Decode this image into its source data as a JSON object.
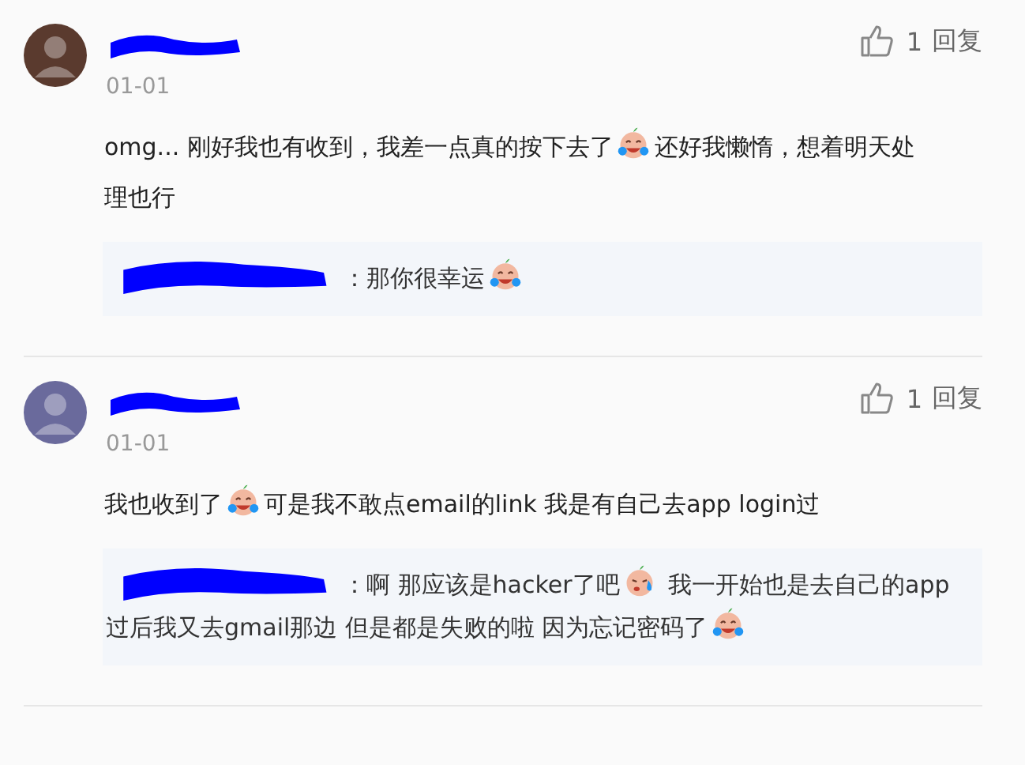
{
  "comments": [
    {
      "avatar": {
        "color": "#5a3a2e"
      },
      "date": "01-01",
      "likes": "1",
      "reply_label": "回复",
      "content": [
        {
          "kind": "text",
          "text": "omg... 刚好我也有收到，我差一点真的按下去了"
        },
        {
          "kind": "laughcry"
        },
        {
          "kind": "text",
          "text": "还好我懒惰，想着明天处理也行"
        }
      ],
      "replies": [
        {
          "content": [
            {
              "kind": "text",
              "text": "：那你很幸运"
            },
            {
              "kind": "laughcry"
            }
          ]
        }
      ]
    },
    {
      "avatar": {
        "color": "#6a6a9c"
      },
      "date": "01-01",
      "likes": "1",
      "reply_label": "回复",
      "content": [
        {
          "kind": "text",
          "text": "我也收到了"
        },
        {
          "kind": "laughcry"
        },
        {
          "kind": "text",
          "text": "可是我不敢点email的link 我是有自己去app login过"
        }
      ],
      "replies": [
        {
          "content": [
            {
              "kind": "text",
              "text": "：啊 那应该是hacker了吧"
            },
            {
              "kind": "sweat"
            },
            {
              "kind": "text",
              "text": " 我一开始也是去自己的app 过后我又去gmail那边 但是都是失败的啦 因为忘记密码了"
            },
            {
              "kind": "laughcry"
            }
          ]
        }
      ]
    }
  ]
}
